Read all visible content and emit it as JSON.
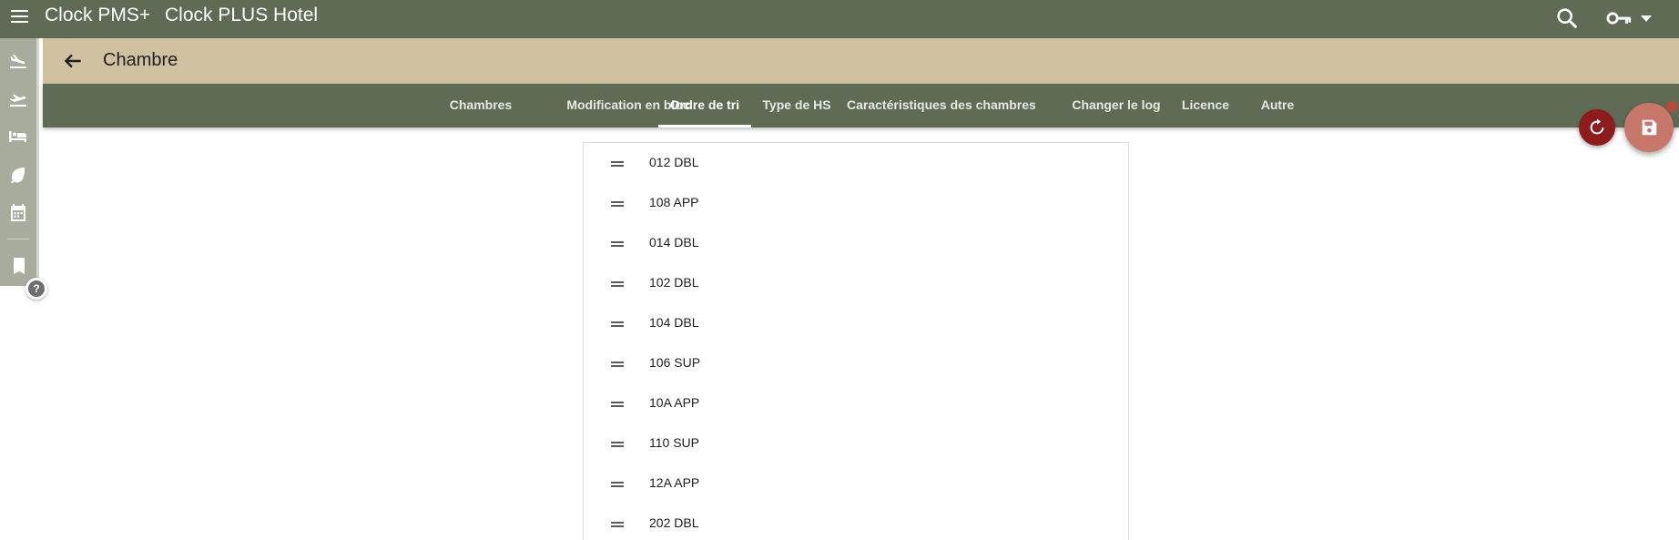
{
  "header": {
    "app_name": "Clock PMS+",
    "hotel_name": "Clock PLUS Hotel",
    "icons": [
      "menu-icon",
      "search-icon",
      "key-icon",
      "caret-down-icon"
    ]
  },
  "sidebar": {
    "items": [
      {
        "icon": "arrivals-icon"
      },
      {
        "icon": "departures-icon"
      },
      {
        "icon": "bed-icon"
      },
      {
        "icon": "leaf-icon"
      },
      {
        "icon": "calendar-icon"
      },
      {
        "icon": "bookmarks-icon"
      }
    ],
    "help_label": "?"
  },
  "subheader": {
    "title": "Chambre",
    "back_icon": "arrow-back-icon"
  },
  "tabs": [
    {
      "label": "Chambres",
      "active": false
    },
    {
      "label": "Modification en bloc",
      "active": false
    },
    {
      "label": "Ordre de tri",
      "active": true
    },
    {
      "label": "Type de HS",
      "active": false
    },
    {
      "label": "Caractéristiques des chambres",
      "active": false
    },
    {
      "label": "Changer le log",
      "active": false
    },
    {
      "label": "Licence",
      "active": false
    },
    {
      "label": "Autre",
      "active": false
    }
  ],
  "actions": {
    "reset_icon": "refresh-icon",
    "save_icon": "save-icon"
  },
  "rooms": [
    "012 DBL",
    "108 APP",
    "014 DBL",
    "102 DBL",
    "104 DBL",
    "106 SUP",
    "10A APP",
    "110 SUP",
    "12A APP",
    "202 DBL"
  ],
  "colors": {
    "topbar": "#606b55",
    "subheader": "#d0c1a0",
    "rail": "#a7ac9c",
    "reset_fab": "#8e1c1c",
    "save_fab": "#c7786a"
  }
}
